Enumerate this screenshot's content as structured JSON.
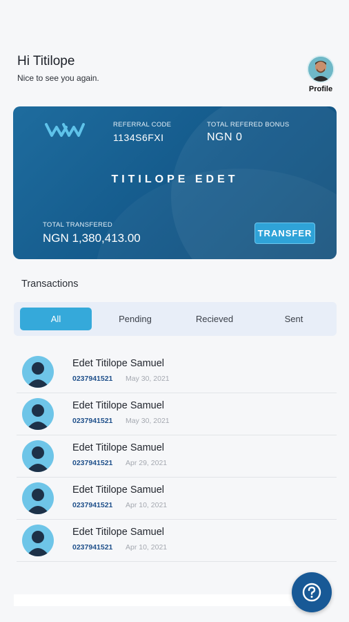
{
  "header": {
    "greeting": "Hi Titilope",
    "subtitle": "Nice to see you again.",
    "profile_label": "Profile"
  },
  "card": {
    "referral_code_label": "REFERRAL CODE",
    "referral_code": "1134S6FXI",
    "bonus_label": "TOTAL REFERED BONUS",
    "bonus_value": "NGN 0",
    "holder_name": "TITILOPE EDET",
    "total_label": "TOTAL TRANSFERED",
    "total_value": "NGN 1,380,413.00",
    "transfer_label": "TRANSFER"
  },
  "transactions": {
    "title": "Transactions",
    "tabs": [
      {
        "label": "All",
        "active": true
      },
      {
        "label": "Pending",
        "active": false
      },
      {
        "label": "Recieved",
        "active": false
      },
      {
        "label": "Sent",
        "active": false
      }
    ],
    "items": [
      {
        "name": "Edet Titilope Samuel",
        "account": "0237941521",
        "date": "May 30, 2021"
      },
      {
        "name": "Edet Titilope Samuel",
        "account": "0237941521",
        "date": "May 30, 2021"
      },
      {
        "name": "Edet Titilope Samuel",
        "account": "0237941521",
        "date": "Apr 29, 2021"
      },
      {
        "name": "Edet Titilope Samuel",
        "account": "0237941521",
        "date": "Apr 10, 2021"
      },
      {
        "name": "Edet Titilope Samuel",
        "account": "0237941521",
        "date": "Apr 10, 2021"
      }
    ]
  },
  "icons": {
    "logo": "brand-logo-icon",
    "avatar": "user-avatar-icon",
    "help": "help-icon"
  },
  "colors": {
    "card": "#14598a",
    "accent": "#35a9da",
    "help_button": "#185996"
  }
}
